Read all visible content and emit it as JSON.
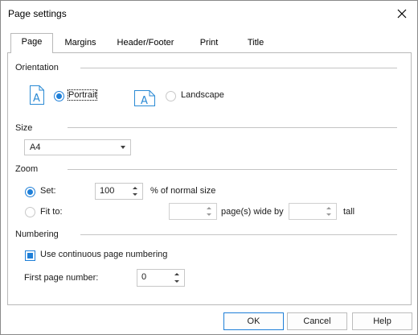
{
  "window": {
    "title": "Page settings"
  },
  "tabs": [
    {
      "label": "Page",
      "active": true
    },
    {
      "label": "Margins",
      "active": false
    },
    {
      "label": "Header/Footer",
      "active": false
    },
    {
      "label": "Print",
      "active": false
    },
    {
      "label": "Title",
      "active": false
    }
  ],
  "orientation": {
    "section_label": "Orientation",
    "portrait_label": "Portrait",
    "landscape_label": "Landscape",
    "selected": "Portrait",
    "portrait_icon_glyph": "A",
    "landscape_icon_glyph": "A"
  },
  "size": {
    "section_label": "Size",
    "selected": "A4"
  },
  "zoom": {
    "section_label": "Zoom",
    "set_label": "Set:",
    "set_value": "100",
    "percent_label": "% of normal size",
    "fit_label": "Fit to:",
    "wide_value": "",
    "wide_label": "page(s) wide by",
    "tall_value": "",
    "tall_label": "tall",
    "selected": "Set"
  },
  "numbering": {
    "section_label": "Numbering",
    "continuous_label": "Use continuous page numbering",
    "continuous_checked": true,
    "first_page_label": "First page number:",
    "first_page_value": "0"
  },
  "buttons": {
    "ok": "OK",
    "cancel": "Cancel",
    "help": "Help"
  },
  "colors": {
    "accent": "#1e7fd8",
    "icon_blue": "#2a8ad4"
  },
  "icons": {
    "close": "close-icon",
    "portrait": "portrait-page-icon",
    "landscape": "landscape-page-icon"
  }
}
